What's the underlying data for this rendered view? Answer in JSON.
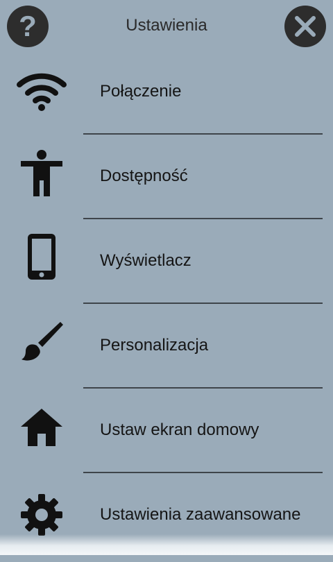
{
  "header": {
    "title": "Ustawienia",
    "help_icon": "question-mark-icon",
    "close_icon": "close-icon"
  },
  "menu": {
    "items": [
      {
        "label": "Połączenie",
        "icon": "wifi-icon"
      },
      {
        "label": "Dostępność",
        "icon": "accessibility-icon"
      },
      {
        "label": "Wyświetlacz",
        "icon": "phone-icon"
      },
      {
        "label": "Personalizacja",
        "icon": "brush-icon"
      },
      {
        "label": "Ustaw ekran domowy",
        "icon": "home-icon"
      },
      {
        "label": "Ustawienia zaawansowane",
        "icon": "gear-icon"
      }
    ]
  },
  "colors": {
    "background": "#9aabb9",
    "circle_button": "#2d2d2d",
    "divider": "#3e444a",
    "text": "#151515"
  }
}
